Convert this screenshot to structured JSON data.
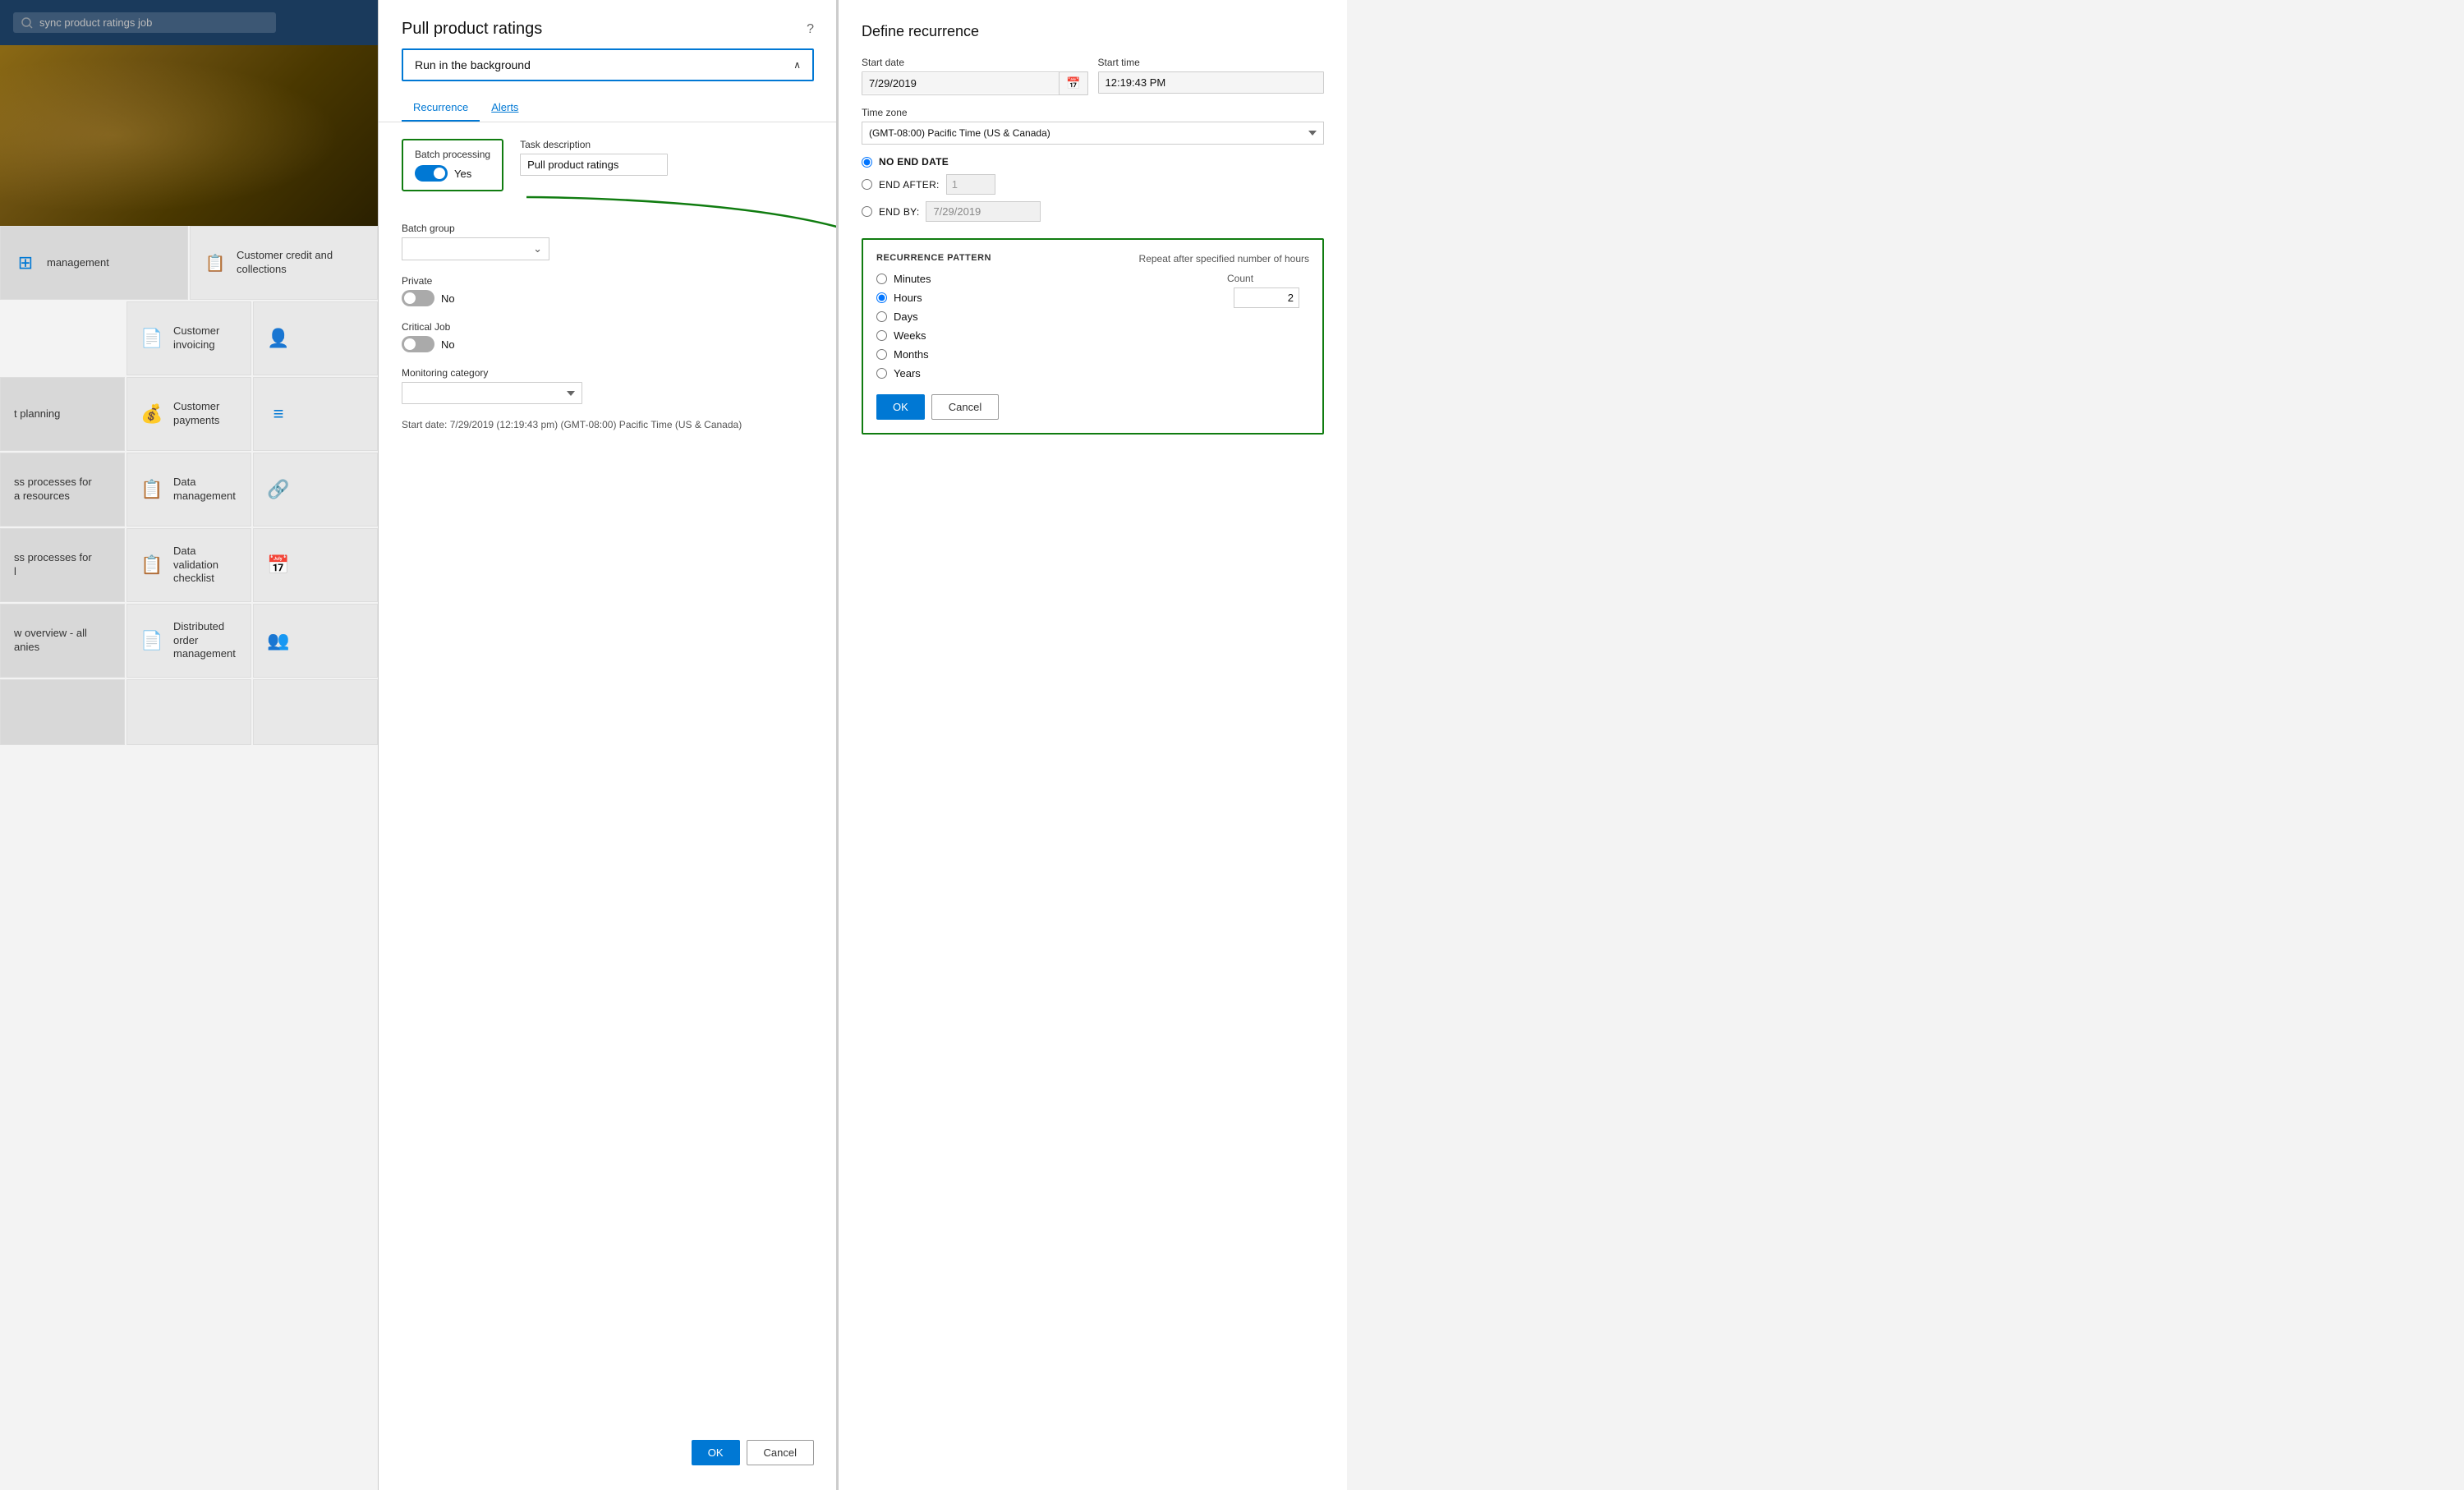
{
  "app": {
    "search_placeholder": "sync product ratings job"
  },
  "nav_tiles": [
    {
      "id": "management",
      "icon": "⊞",
      "label": "management",
      "col": "left"
    },
    {
      "id": "customer-credit",
      "icon": "📋",
      "label": "Customer credit and collections",
      "col": "right"
    },
    {
      "id": "right2",
      "icon": "⚙",
      "label": "",
      "col": "right"
    },
    {
      "id": "left2",
      "icon": "⊞",
      "label": "t planning",
      "col": "left"
    },
    {
      "id": "customer-invoicing",
      "icon": "📄",
      "label": "Customer invoicing",
      "col": "right"
    },
    {
      "id": "right3",
      "icon": "👤",
      "label": "",
      "col": "right"
    },
    {
      "id": "left3",
      "icon": "⊞",
      "label": "ss processes for a resources",
      "col": "left"
    },
    {
      "id": "customer-payments",
      "icon": "💰",
      "label": "Customer payments",
      "col": "right"
    },
    {
      "id": "right4",
      "icon": "≡",
      "label": "",
      "col": "right"
    },
    {
      "id": "left4",
      "icon": "⊞",
      "label": "ss processes for l",
      "col": "left"
    },
    {
      "id": "data-management",
      "icon": "📋",
      "label": "Data management",
      "col": "right"
    },
    {
      "id": "right5",
      "icon": "🔗",
      "label": "",
      "col": "right"
    },
    {
      "id": "left5",
      "icon": "⊞",
      "label": "w overview - all anies",
      "col": "left"
    },
    {
      "id": "data-validation",
      "icon": "📋",
      "label": "Data validation checklist",
      "col": "right"
    },
    {
      "id": "right6",
      "icon": "📅",
      "label": "",
      "col": "right"
    },
    {
      "id": "left6",
      "icon": "⊞",
      "label": "",
      "col": "left"
    },
    {
      "id": "distributed-order",
      "icon": "📄",
      "label": "Distributed order management",
      "col": "right"
    },
    {
      "id": "right7",
      "icon": "👥",
      "label": "",
      "col": "right"
    }
  ],
  "pull_product_modal": {
    "title": "Pull product ratings",
    "help_icon": "?",
    "run_bg_label": "Run in the background",
    "tabs": [
      {
        "id": "recurrence",
        "label": "Recurrence",
        "active": true
      },
      {
        "id": "alerts",
        "label": "Alerts",
        "active": false
      }
    ],
    "batch_processing": {
      "label": "Batch processing",
      "value": "Yes",
      "enabled": true
    },
    "task_description": {
      "label": "Task description",
      "value": "Pull product ratings"
    },
    "batch_group": {
      "label": "Batch group",
      "value": ""
    },
    "private": {
      "label": "Private",
      "value": "No"
    },
    "critical_job": {
      "label": "Critical Job",
      "value": "No"
    },
    "monitoring_category": {
      "label": "Monitoring category",
      "value": ""
    },
    "start_date_info": "Start date: 7/29/2019 (12:19:43 pm) (GMT-08:00) Pacific Time (US & Canada)",
    "ok_button": "OK",
    "cancel_button": "Cancel"
  },
  "define_recurrence": {
    "title": "Define recurrence",
    "start_date_label": "Start date",
    "start_date_value": "7/29/2019",
    "start_time_label": "Start time",
    "start_time_value": "12:19:43 PM",
    "timezone_label": "Time zone",
    "timezone_value": "(GMT-08:00) Pacific Time (US & Canada)",
    "no_end_date_label": "NO END DATE",
    "end_after_label": "END AFTER:",
    "end_after_count": "1",
    "end_by_label": "END BY:",
    "end_by_value": "7/29/2019",
    "recurrence_pattern": {
      "title": "RECURRENCE PATTERN",
      "repeat_label": "Repeat after specified number of hours",
      "count_label": "Count",
      "count_value": "2",
      "options": [
        {
          "id": "minutes",
          "label": "Minutes",
          "selected": false
        },
        {
          "id": "hours",
          "label": "Hours",
          "selected": true
        },
        {
          "id": "days",
          "label": "Days",
          "selected": false
        },
        {
          "id": "weeks",
          "label": "Weeks",
          "selected": false
        },
        {
          "id": "months",
          "label": "Months",
          "selected": false
        },
        {
          "id": "years",
          "label": "Years",
          "selected": false
        }
      ],
      "ok_button": "OK",
      "cancel_button": "Cancel"
    }
  }
}
